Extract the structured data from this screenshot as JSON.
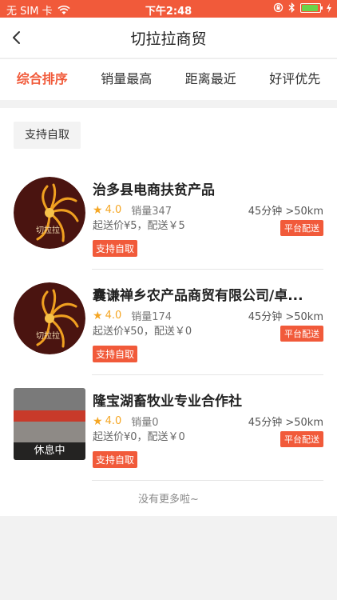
{
  "status_bar": {
    "carrier": "无 SIM 卡",
    "time": "下午2:48",
    "colors": {
      "background": "#f15a3a",
      "battery": "#6ad34a"
    },
    "battery_level": 0.85
  },
  "nav": {
    "title": "切拉拉商贸",
    "back_icon": "chevron-left-icon"
  },
  "tabs": [
    {
      "label": "综合排序",
      "active": true
    },
    {
      "label": "销量最高",
      "active": false
    },
    {
      "label": "距离最近",
      "active": false
    },
    {
      "label": "好评优先",
      "active": false
    }
  ],
  "filter": {
    "chip_label": "支持自取"
  },
  "stores": [
    {
      "name": "治多县电商扶贫产品",
      "rating": "4.0",
      "sales": "销量347",
      "delivery": "45分钟 >50km",
      "min_order": "起送价¥5，配送￥5",
      "badge": "平台配送",
      "tag": "支持自取",
      "image": "logo"
    },
    {
      "name": "囊谦禅乡农产品商贸有限公司/卓...",
      "rating": "4.0",
      "sales": "销量174",
      "delivery": "45分钟 >50km",
      "min_order": "起送价¥50，配送￥0",
      "badge": "平台配送",
      "tag": "支持自取",
      "image": "logo"
    },
    {
      "name": "隆宝湖畜牧业专业合作社",
      "rating": "4.0",
      "sales": "销量0",
      "delivery": "45分钟 >50km",
      "min_order": "起送价¥0，配送￥0",
      "badge": "平台配送",
      "tag": "支持自取",
      "image": "photo",
      "closed_label": "休息中"
    }
  ],
  "footer": {
    "no_more": "没有更多啦~"
  },
  "colors": {
    "accent": "#f15a3a",
    "star": "#f5a623"
  }
}
